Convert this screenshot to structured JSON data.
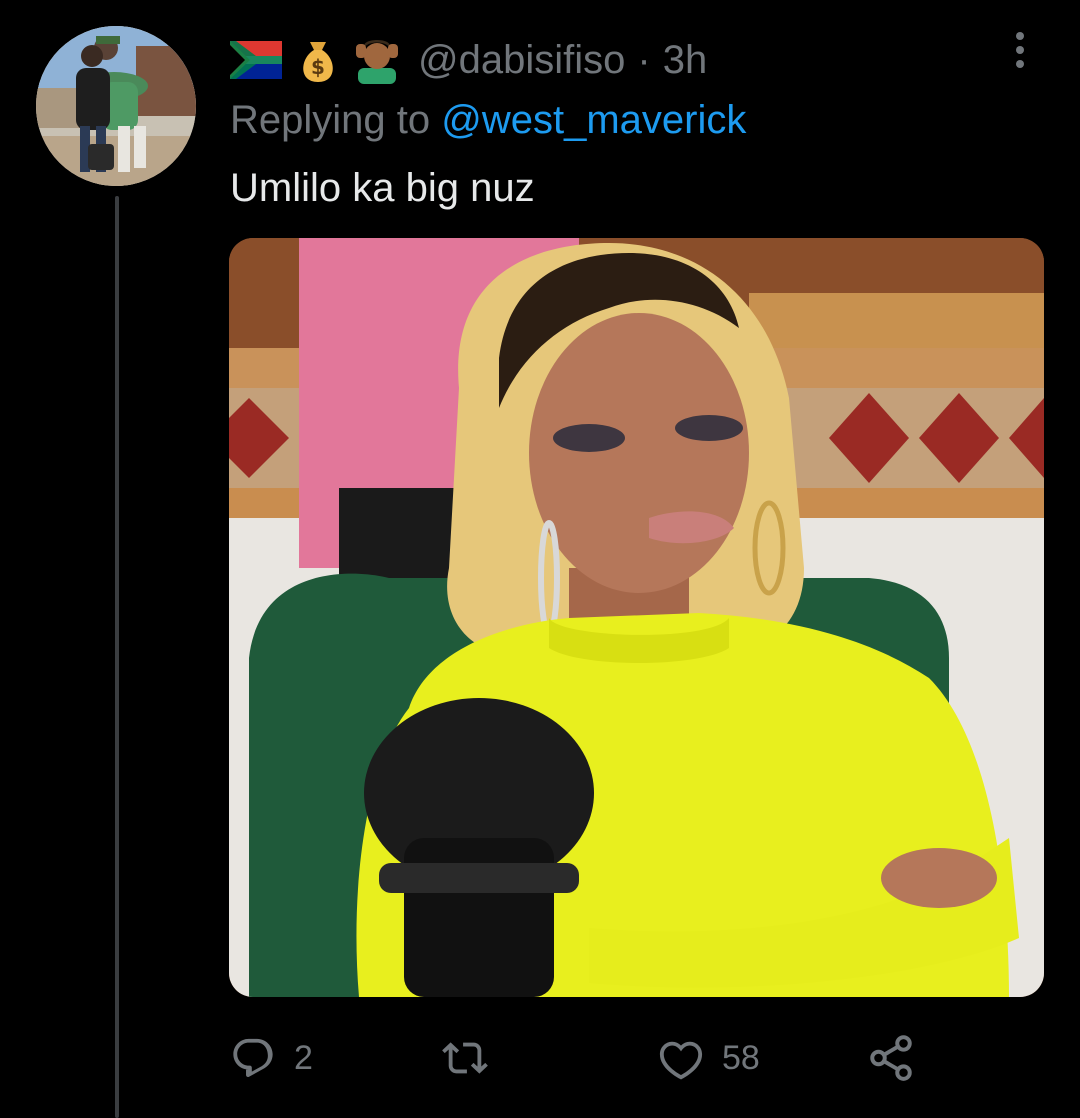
{
  "tweet": {
    "header_emojis": [
      "south-africa-flag-icon",
      "money-bag-icon",
      "person-getting-massage-icon"
    ],
    "handle": "@dabisifiso",
    "separator": "·",
    "time": "3h",
    "replying_prefix": "Replying to",
    "replying_to": "@west_maverick",
    "text": "Umlilo ka big nuz",
    "media_description_icon": "photo",
    "actions": {
      "reply_icon": "reply-icon",
      "reply_count": "2",
      "retweet_icon": "retweet-icon",
      "retweet_count": "",
      "like_icon": "heart-icon",
      "like_count": "58",
      "share_icon": "share-icon"
    }
  },
  "colors": {
    "background": "#000000",
    "secondary_text": "#71767b",
    "primary_text": "#e7e9ea",
    "link": "#1d9bf0",
    "thread_line": "#3a3d40"
  }
}
